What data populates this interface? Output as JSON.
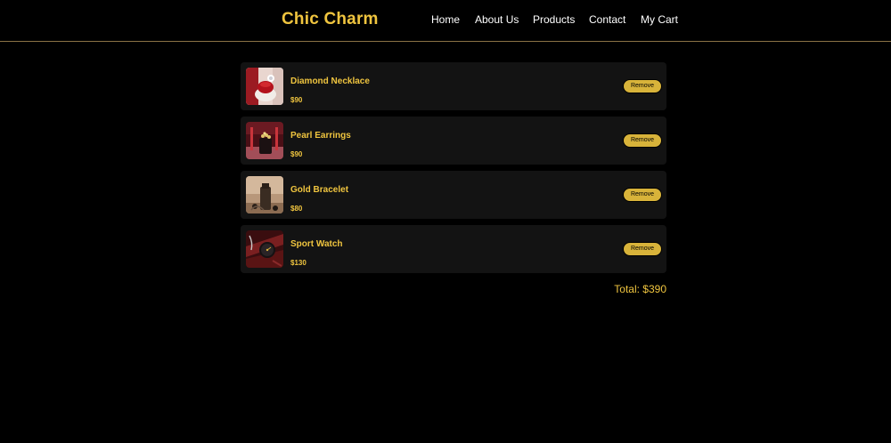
{
  "header": {
    "brand": "Chic Charm",
    "nav": [
      "Home",
      "About Us",
      "Products",
      "Contact",
      "My Cart"
    ]
  },
  "cart": {
    "items": [
      {
        "name": "Diamond Necklace",
        "price": "$90",
        "remove_label": "Remove",
        "image_icon": "necklace-photo"
      },
      {
        "name": "Pearl Earrings",
        "price": "$90",
        "remove_label": "Remove",
        "image_icon": "earrings-photo"
      },
      {
        "name": "Gold Bracelet",
        "price": "$80",
        "remove_label": "Remove",
        "image_icon": "bracelet-photo"
      },
      {
        "name": "Sport Watch",
        "price": "$130",
        "remove_label": "Remove",
        "image_icon": "watch-photo"
      }
    ],
    "total": "Total: $390"
  },
  "colors": {
    "background": "#000000",
    "accent": "#f0c53f",
    "button": "#d8b33a",
    "card": "#131313",
    "divider": "#8a7245"
  }
}
